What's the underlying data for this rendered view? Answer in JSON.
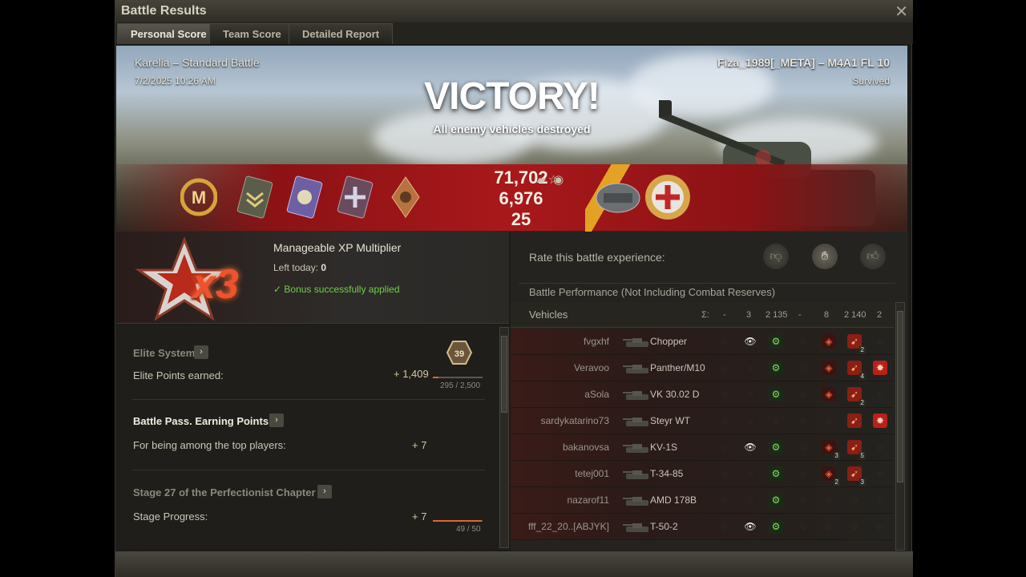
{
  "window": {
    "title": "Battle Results",
    "close_icon": "close-icon"
  },
  "tabs": [
    {
      "label": "Personal Score",
      "active": true
    },
    {
      "label": "Team Score",
      "active": false
    },
    {
      "label": "Detailed Report",
      "active": false
    }
  ],
  "battle": {
    "map_mode": "Karelia – Standard Battle",
    "datetime": "7/2/2025 10:26 AM",
    "player": "Fiza_1989[_META] – M4A1 FL 10",
    "status": "Survived",
    "result": "VICTORY!",
    "result_reason": "All enemy vehicles destroyed"
  },
  "rewards": {
    "credits": "71,702",
    "xp": "6,976",
    "bonds": "25"
  },
  "xp_multiplier": {
    "badge": "x3",
    "title": "Manageable XP Multiplier",
    "left_today_label": "Left today:",
    "left_today_value": "0",
    "bonus_text": "Bonus successfully applied"
  },
  "elite_system": {
    "title": "Elite System",
    "badge_level": "39",
    "earned_label": "Elite Points earned:",
    "earned_value": "+ 1,409",
    "progress": "295 / 2,500",
    "progress_fraction": 0.118
  },
  "battle_pass": {
    "title": "Battle Pass. Earning Points",
    "reason": "For being among the top players:",
    "value": "+ 7"
  },
  "perfectionist": {
    "title": "Stage 27 of the Perfectionist Chapter",
    "label": "Stage Progress:",
    "value": "+ 7",
    "progress": "49 / 50",
    "progress_fraction": 0.98
  },
  "rating": {
    "prompt": "Rate this battle experience:",
    "icons": [
      "thumbs-down-icon",
      "neutral-icon",
      "thumbs-up-icon"
    ]
  },
  "performance": {
    "title": "Battle Performance (Not Including Combat Reserves)",
    "vehicles_header": "Vehicles",
    "totals": [
      "Σ:",
      "-",
      "3",
      "2 135",
      "-",
      "8",
      "2 140",
      "2"
    ],
    "rows": [
      {
        "player": "fvgxhf",
        "vehicle": "Chopper"
      },
      {
        "player": "Veravoo",
        "vehicle": "Panther/M10"
      },
      {
        "player": "aSola",
        "vehicle": "VK 30.02 D"
      },
      {
        "player": "sardykatarino73",
        "vehicle": "Steyr WT"
      },
      {
        "player": "bakanovsa",
        "vehicle": "KV-1S"
      },
      {
        "player": "tetej001",
        "vehicle": "T-34-85"
      },
      {
        "player": "nazarof11",
        "vehicle": "AMD 178B"
      },
      {
        "player": "fff_22_20..[ABJYK]",
        "vehicle": "T-50-2"
      }
    ],
    "badge_counts": {
      "r1": "2",
      "r2": "4",
      "r3": "2",
      "r5a": "3",
      "r5b": "5",
      "r6a": "2",
      "r6b": "3"
    }
  },
  "colors": {
    "accent_red": "#a8181b",
    "bonus_green": "#6fcf4a",
    "progress_orange": "#e0643a",
    "stripe_gold": "#e4a224"
  }
}
